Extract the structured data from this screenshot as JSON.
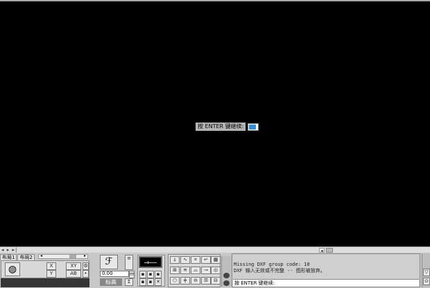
{
  "canvas": {
    "prompt_label": "按 ENTER 键继续:",
    "accent_color": "#2e8ddc"
  },
  "statusbar": {
    "nav_arrows": "◂ ▸ ▸|",
    "tabs": [
      "布局1",
      "布局2"
    ]
  },
  "toolbar": {
    "elevation_value": "0.00",
    "elevation_label": "标高",
    "xy_labels": [
      "XY",
      "AB"
    ],
    "icons": [
      "globe-icon",
      "axis-x-icon",
      "axis-y-icon",
      "text-icon",
      "sigma-icon"
    ]
  },
  "command_line": {
    "history": [
      "Missing DXF group code: 10",
      "DXF 输入无效或不完整 -- 图形被放弃。"
    ],
    "input_prompt": "按 ENTER 键继续:"
  }
}
